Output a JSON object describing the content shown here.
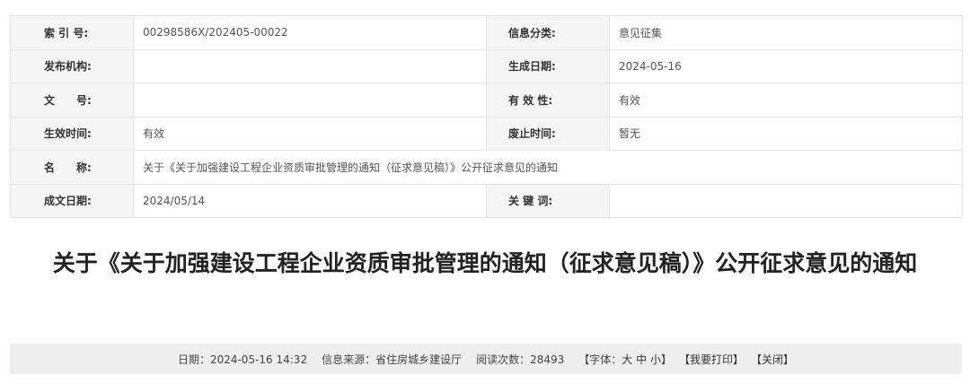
{
  "meta": {
    "index_label": "索 引 号:",
    "index_value": "00298586X/202405-00022",
    "category_label": "信息分类:",
    "category_value": "意见征集",
    "publisher_label": "发布机构:",
    "publisher_value": "",
    "created_date_label": "生成日期:",
    "created_date_value": "2024-05-16",
    "doc_no_label": "文　　号:",
    "doc_no_value": "",
    "validity_label": "有 效 性:",
    "validity_value": "有效",
    "effective_time_label": "生效时间:",
    "effective_time_value": "有效",
    "abolish_time_label": "废止时间:",
    "abolish_time_value": "暂无",
    "name_label": "名　　称:",
    "name_value": "关于《关于加强建设工程企业资质审批管理的通知（征求意见稿）》公开征求意见的通知",
    "written_date_label": "成文日期:",
    "written_date_value": "2024/05/14",
    "keywords_label": "关 键 词:",
    "keywords_value": ""
  },
  "article": {
    "title": "关于《关于加强建设工程企业资质审批管理的通知（征求意见稿）》公开征求意见的通知"
  },
  "infobar": {
    "date": "日期：2024-05-16 14:32",
    "source": "信息来源：省住房城乡建设厅",
    "reads": "阅读次数：28493",
    "font_open": "【字体：",
    "font_large": "大",
    "font_medium": "中",
    "font_small": "小",
    "font_close": "】",
    "print": "【我要打印】",
    "close": "【关闭】"
  }
}
